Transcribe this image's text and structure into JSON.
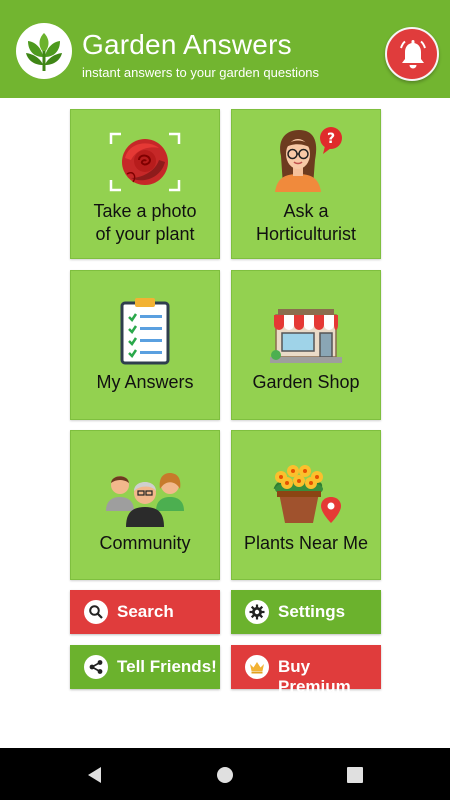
{
  "header": {
    "title": "Garden Answers",
    "subtitle": "instant answers to your garden questions",
    "logo_icon": "leaf-logo-icon",
    "notification_icon": "bell-icon",
    "bar_color": "#72b530",
    "bell_color": "#e03c3c"
  },
  "tiles": [
    {
      "line1": "Take a photo",
      "line2": "of your plant",
      "icon": "rose-camera-icon"
    },
    {
      "line1": "Ask a",
      "line2": "Horticulturist",
      "icon": "horticulturist-icon"
    },
    {
      "line1": "My Answers",
      "icon": "clipboard-checklist-icon"
    },
    {
      "line1": "Garden Shop",
      "icon": "storefront-icon"
    },
    {
      "line1": "Community",
      "icon": "community-people-icon"
    },
    {
      "line1": "Plants Near Me",
      "icon": "flower-pot-location-icon"
    }
  ],
  "buttons": {
    "search": {
      "label": "Search",
      "icon": "search-icon"
    },
    "settings": {
      "label": "Settings",
      "icon": "gear-icon"
    },
    "tell_friends": {
      "label": "Tell Friends!",
      "icon": "share-icon"
    },
    "buy_premium": {
      "label": "Buy Premium",
      "icon": "crown-icon"
    }
  },
  "navbar": {
    "back_icon": "back-icon",
    "home_icon": "home-icon",
    "recents_icon": "recents-icon"
  },
  "colors": {
    "tile": "#93d150",
    "red_button": "#e03c3c",
    "green_button": "#6bb22d"
  }
}
